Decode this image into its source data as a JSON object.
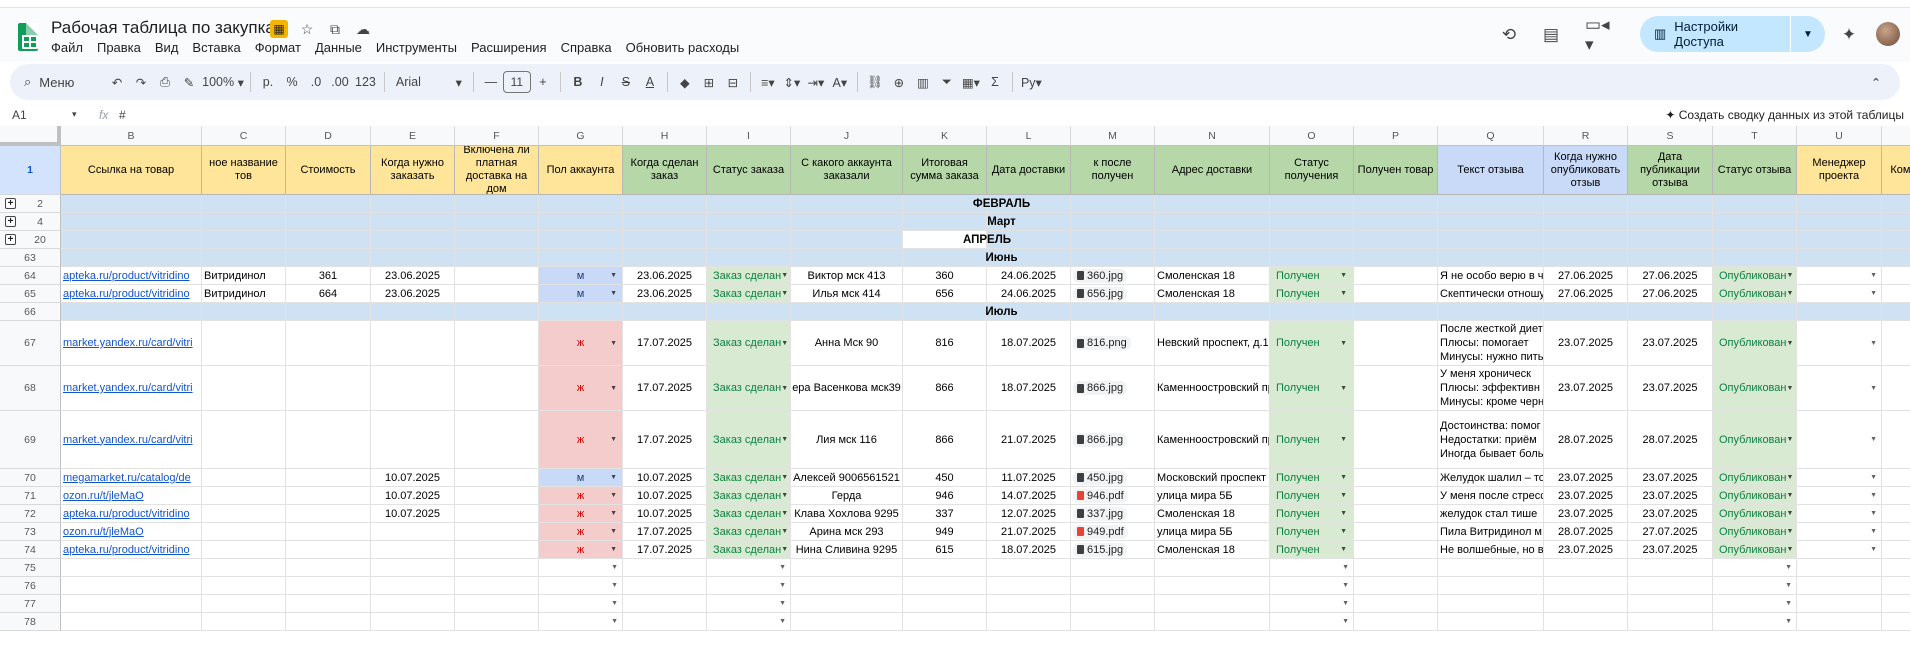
{
  "doc_title": "Рабочая таблица по закупкам",
  "menu": [
    "Файл",
    "Правка",
    "Вид",
    "Вставка",
    "Формат",
    "Данные",
    "Инструменты",
    "Расширения",
    "Справка",
    "Обновить расходы"
  ],
  "share_label": "Настройки Доступа",
  "toolbar": {
    "search_label": "Меню",
    "zoom": "100%",
    "currency": "р.",
    "percent": "%",
    "dec_minus": ".0",
    "dec_plus": ".00",
    "num_format": "123",
    "font": "Arial",
    "font_size": "11",
    "bold": "B",
    "italic": "I",
    "strike": "S",
    "text_color": "A"
  },
  "formula_bar": {
    "cell_ref": "A1",
    "fx": "fx",
    "value": "#",
    "summary_action": "Создать сводку данных из этой таблицы"
  },
  "columns": [
    "B",
    "C",
    "D",
    "E",
    "F",
    "G",
    "H",
    "I",
    "J",
    "K",
    "L",
    "M",
    "N",
    "O",
    "P",
    "Q",
    "R",
    "S",
    "T",
    "U",
    ""
  ],
  "header_row": {
    "row_num": "1",
    "cells": [
      "Ссылка на товар",
      "ное название тов",
      "Стоимость",
      "Когда нужно заказать",
      "Включена ли платная доставка на дом",
      "Пол аккаунта",
      "Когда сделан заказ",
      "Статус заказа",
      "С какого аккаунта заказали",
      "Итоговая сумма заказа",
      "Дата доставки",
      "к после получен",
      "Адрес доставки",
      "Статус получения",
      "Получен товар",
      "Текст отзыва",
      "Когда нужно опубликовать отзыв",
      "Дата публикации отзыва",
      "Статус отзыва",
      "Менеджер проекта",
      "Комм ес"
    ]
  },
  "month_rows": [
    {
      "row_num": "2",
      "label": "ФЕВРАЛЬ",
      "grouped": true
    },
    {
      "row_num": "4",
      "label": "Март",
      "grouped": true
    },
    {
      "row_num": "20",
      "label": "АПРЕЛЬ",
      "grouped": true
    },
    {
      "row_num": "63",
      "label": "Июнь",
      "grouped": false
    },
    {
      "row_num": "66",
      "label": "Июль",
      "grouped": false
    }
  ],
  "rows": [
    {
      "n": "64",
      "link": "apteka.ru/product/vitridino",
      "name": "Витридинол",
      "cost": "361",
      "when_order": "23.06.2025",
      "delivery": "",
      "gender": "м",
      "ordered": "23.06.2025",
      "status": "Заказ сделан",
      "account": "Виктор мск 413",
      "total": "360",
      "delivery_date": "24.06.2025",
      "file": "360.jpg",
      "file_type": "img",
      "address": "Смоленская 18",
      "recv_status": "Получен",
      "recv_item": "",
      "review": [
        "Я не особо верю в чу"
      ],
      "publish_due": "27.06.2025",
      "publish_date": "27.06.2025",
      "review_status": "Опубликован"
    },
    {
      "n": "65",
      "link": "apteka.ru/product/vitridino",
      "name": "Витридинол",
      "cost": "664",
      "when_order": "23.06.2025",
      "delivery": "",
      "gender": "м",
      "ordered": "23.06.2025",
      "status": "Заказ сделан",
      "account": "Илья мск 414",
      "total": "656",
      "delivery_date": "24.06.2025",
      "file": "656.jpg",
      "file_type": "img",
      "address": "Смоленская 18",
      "recv_status": "Получен",
      "recv_item": "",
      "review": [
        "Скептически отношу"
      ],
      "publish_due": "27.06.2025",
      "publish_date": "27.06.2025",
      "review_status": "Опубликован"
    },
    {
      "n": "67",
      "link": "market.yandex.ru/card/vitri",
      "name": "",
      "cost": "",
      "when_order": "",
      "delivery": "",
      "gender": "ж",
      "ordered": "17.07.2025",
      "status": "Заказ сделан",
      "account": "Анна Мск 90",
      "total": "816",
      "delivery_date": "18.07.2025",
      "file": "816.png",
      "file_type": "img",
      "address": "Невский проспект, д.1",
      "recv_status": "Получен",
      "recv_item": "",
      "review": [
        "После жесткой дието",
        "Плюсы: помогает",
        "Минусы: нужно пить"
      ],
      "publish_due": "23.07.2025",
      "publish_date": "23.07.2025",
      "review_status": "Опубликован"
    },
    {
      "n": "68",
      "link": "market.yandex.ru/card/vitri",
      "name": "",
      "cost": "",
      "when_order": "",
      "delivery": "",
      "gender": "ж",
      "ordered": "17.07.2025",
      "status": "Заказ сделан",
      "account": "ера Васенкова мск39",
      "total": "866",
      "delivery_date": "18.07.2025",
      "file": "866.jpg",
      "file_type": "img",
      "address": "Каменноостровский пр",
      "recv_status": "Получен",
      "recv_item": "",
      "review": [
        "У меня хроническ",
        "Плюсы: эффективн",
        "Минусы: кроме черн"
      ],
      "publish_due": "23.07.2025",
      "publish_date": "23.07.2025",
      "review_status": "Опубликован"
    },
    {
      "n": "69",
      "link": "market.yandex.ru/card/vitri",
      "name": "",
      "cost": "",
      "when_order": "",
      "delivery": "",
      "gender": "ж",
      "ordered": "17.07.2025",
      "status": "Заказ сделан",
      "account": "Лия мск 116",
      "total": "866",
      "delivery_date": "21.07.2025",
      "file": "866.jpg",
      "file_type": "img",
      "address": "Каменноостровский пр",
      "recv_status": "Получен",
      "recv_item": "",
      "review": [
        "Достоинства: помог",
        "Недостатки: приём",
        "Иногда бывает боль"
      ],
      "publish_due": "28.07.2025",
      "publish_date": "28.07.2025",
      "review_status": "Опубликован"
    },
    {
      "n": "70",
      "link": "megamarket.ru/catalog/de",
      "name": "",
      "cost": "",
      "when_order": "10.07.2025",
      "delivery": "",
      "gender": "м",
      "ordered": "10.07.2025",
      "status": "Заказ сделан",
      "account": "Алексей 9006561521",
      "total": "450",
      "delivery_date": "11.07.2025",
      "file": "450.jpg",
      "file_type": "img",
      "address": "Московский проспект",
      "recv_status": "Получен",
      "recv_item": "",
      "review": [
        "Желудок шалил – то"
      ],
      "publish_due": "23.07.2025",
      "publish_date": "23.07.2025",
      "review_status": "Опубликован"
    },
    {
      "n": "71",
      "link": "ozon.ru/t/jleMaO",
      "name": "",
      "cost": "",
      "when_order": "10.07.2025",
      "delivery": "",
      "gender": "ж",
      "ordered": "10.07.2025",
      "status": "Заказ сделан",
      "account": "Герда",
      "total": "946",
      "delivery_date": "14.07.2025",
      "file": "946.pdf",
      "file_type": "pdf",
      "address": "улица мира 5Б",
      "recv_status": "Получен",
      "recv_item": "",
      "review": [
        "У меня после стресс"
      ],
      "publish_due": "23.07.2025",
      "publish_date": "23.07.2025",
      "review_status": "Опубликован"
    },
    {
      "n": "72",
      "link": "apteka.ru/product/vitridino",
      "name": "",
      "cost": "",
      "when_order": "10.07.2025",
      "delivery": "",
      "gender": "ж",
      "ordered": "10.07.2025",
      "status": "Заказ сделан",
      "account": "Клава Хохлова 9295",
      "total": "337",
      "delivery_date": "12.07.2025",
      "file": "337.jpg",
      "file_type": "img",
      "address": "Смоленская 18",
      "recv_status": "Получен",
      "recv_item": "",
      "review": [
        "желудок стал тише"
      ],
      "publish_due": "23.07.2025",
      "publish_date": "23.07.2025",
      "review_status": "Опубликован"
    },
    {
      "n": "73",
      "link": "ozon.ru/t/jleMaO",
      "name": "",
      "cost": "",
      "when_order": "",
      "delivery": "",
      "gender": "ж",
      "ordered": "17.07.2025",
      "status": "Заказ сделан",
      "account": "Арина мск 293",
      "total": "949",
      "delivery_date": "21.07.2025",
      "file": "949.pdf",
      "file_type": "pdf",
      "address": "улица мира 5Б",
      "recv_status": "Получен",
      "recv_item": "",
      "review": [
        "Пила Витридинол м"
      ],
      "publish_due": "28.07.2025",
      "publish_date": "27.07.2025",
      "review_status": "Опубликован"
    },
    {
      "n": "74",
      "link": "apteka.ru/product/vitridino",
      "name": "",
      "cost": "",
      "when_order": "",
      "delivery": "",
      "gender": "ж",
      "ordered": "17.07.2025",
      "status": "Заказ сделан",
      "account": "Нина Сливина 9295",
      "total": "615",
      "delivery_date": "18.07.2025",
      "file": "615.jpg",
      "file_type": "img",
      "address": "Смоленская 18",
      "recv_status": "Получен",
      "recv_item": "",
      "review": [
        "Не волшебные, но в"
      ],
      "publish_due": "23.07.2025",
      "publish_date": "23.07.2025",
      "review_status": "Опубликован"
    }
  ],
  "empty_rows": [
    "75",
    "76",
    "77",
    "78"
  ]
}
